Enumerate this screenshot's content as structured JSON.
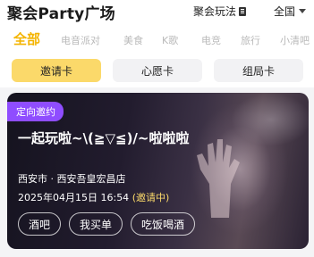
{
  "header": {
    "title": "聚会Party广场",
    "guide_label": "聚会玩法",
    "region_label": "全国"
  },
  "categories": [
    "全部",
    "电音派对",
    "美食",
    "K歌",
    "电竞",
    "旅行",
    "小清吧"
  ],
  "subtabs": [
    "邀请卡",
    "心愿卡",
    "组局卡"
  ],
  "card": {
    "badge": "定向邀约",
    "title": "一起玩啦~\\(≧▽≦)/~啦啦啦",
    "place": "西安市 · 西安吾皇宏昌店",
    "time": "2025年04月15日 16:54",
    "status": "(邀请中)",
    "tags": [
      "酒吧",
      "我买单",
      "吃饭喝酒"
    ]
  },
  "colors": {
    "accent": "#f4b400",
    "subtab_active": "#fbd96a",
    "badge": "#8f4dff"
  }
}
